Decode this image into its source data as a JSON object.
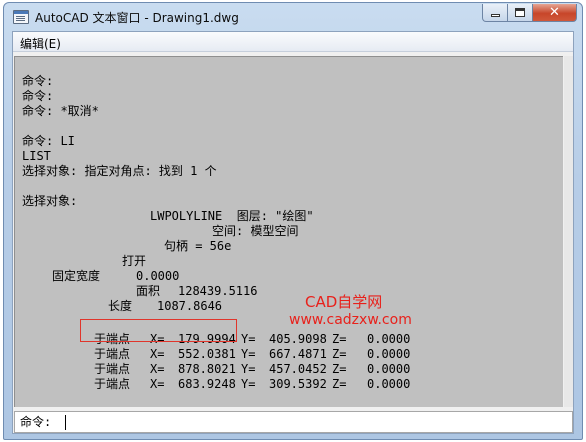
{
  "window": {
    "title": "AutoCAD 文本窗口 - Drawing1.dwg"
  },
  "menubar": {
    "items": [
      {
        "label": "编辑(E)"
      }
    ]
  },
  "history": {
    "lines": [
      "命令:",
      "命令:",
      "命令: *取消*",
      "命令: LI",
      "LIST",
      "选择对象: 指定对角点: 找到 1 个",
      "选择对象:",
      "LWPOLYLINE  图层: \"绘图\"",
      "空间: 模型空间",
      "句柄 = 56e",
      "打开",
      "固定宽度",
      "0.0000",
      "面积",
      "128439.5116",
      "长度",
      "1087.8646"
    ],
    "vertices": [
      {
        "label": "于端点",
        "x_label": "X=",
        "x": "179.9994",
        "y_label": "Y=",
        "y": "405.9098",
        "z_label": "Z=",
        "z": "0.0000"
      },
      {
        "label": "于端点",
        "x_label": "X=",
        "x": "552.0381",
        "y_label": "Y=",
        "y": "667.4871",
        "z_label": "Z=",
        "z": "0.0000"
      },
      {
        "label": "于端点",
        "x_label": "X=",
        "x": "878.8021",
        "y_label": "Y=",
        "y": "457.0452",
        "z_label": "Z=",
        "z": "0.0000"
      },
      {
        "label": "于端点",
        "x_label": "X=",
        "x": "683.9248",
        "y_label": "Y=",
        "y": "309.5392",
        "z_label": "Z=",
        "z": "0.0000"
      }
    ]
  },
  "command_line": {
    "prompt": "命令:"
  },
  "watermark": {
    "name": "CAD自学网",
    "url": "www.cadzxw.com",
    "color": "#e8211b"
  },
  "highlight": {
    "color": "#e0352b"
  }
}
